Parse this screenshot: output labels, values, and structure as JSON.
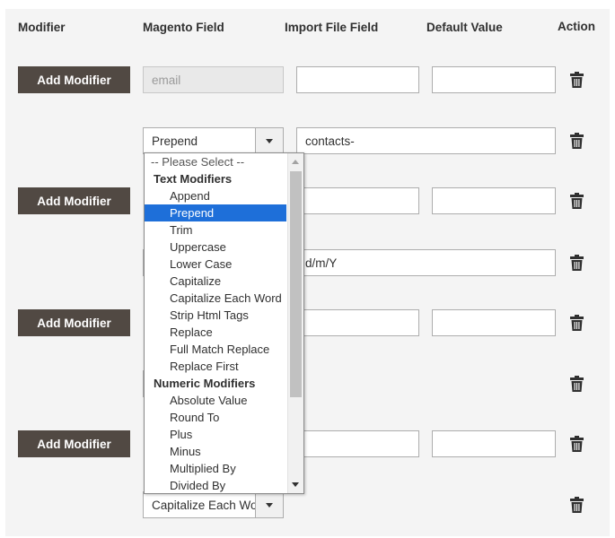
{
  "headers": {
    "modifier": "Modifier",
    "magento_field": "Magento Field",
    "import_file_field": "Import File Field",
    "default_value": "Default Value",
    "action": "Action"
  },
  "add_modifier_label": "Add Modifier",
  "rows": {
    "r1": {
      "magento_field": "email",
      "import_file_field": "",
      "default_value": ""
    },
    "r2": {
      "modifier_select": "Prepend",
      "modifier_value": "contacts-"
    },
    "r3": {
      "import_file_field": "",
      "default_value": ""
    },
    "r4": {
      "modifier_value": "d/m/Y"
    },
    "r5": {
      "import_file_field": "",
      "default_value": ""
    },
    "r6": {
      "import_file_field": "",
      "default_value": ""
    },
    "r7": {
      "modifier_select": "Capitalize Each Word"
    }
  },
  "dropdown": {
    "placeholder": "-- Please Select --",
    "group_text": "Text Modifiers",
    "text_options": [
      "Append",
      "Prepend",
      "Trim",
      "Uppercase",
      "Lower Case",
      "Capitalize",
      "Capitalize Each Word",
      "Strip Html Tags",
      "Replace",
      "Full Match Replace",
      "Replace First"
    ],
    "group_numeric": "Numeric Modifiers",
    "numeric_options": [
      "Absolute Value",
      "Round To",
      "Plus",
      "Minus",
      "Multiplied By",
      "Divided By"
    ],
    "selected": "Prepend"
  },
  "colors": {
    "button_bg": "#514943",
    "selected_option": "#1e6fd9",
    "panel_bg": "#f4f4f4"
  },
  "icons": {
    "delete": "trash-icon",
    "select_arrow": "chevron-down-icon"
  }
}
